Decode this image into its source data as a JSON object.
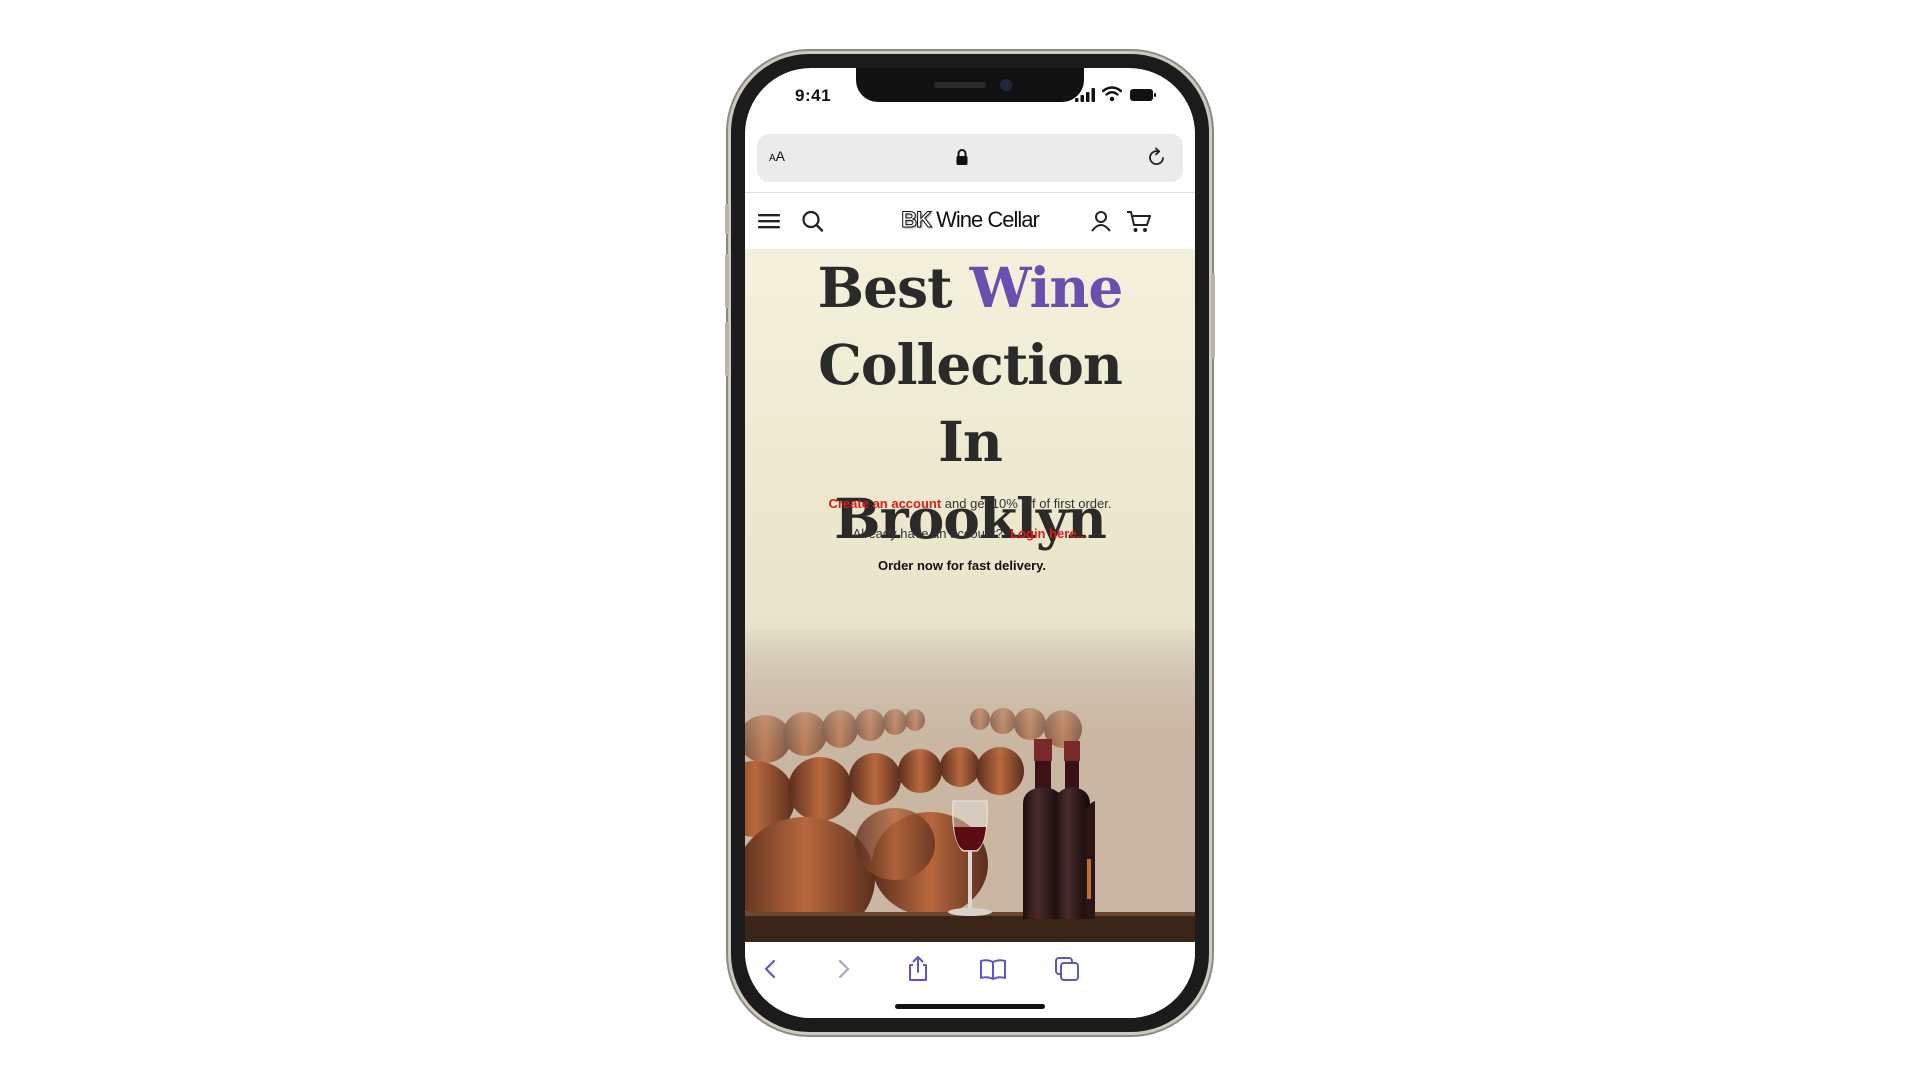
{
  "status_bar": {
    "time": "9:41"
  },
  "browser": {
    "text_size_label_small": "A",
    "text_size_label_large": "A"
  },
  "site": {
    "logo_prefix": "BK",
    "logo_text": " Wine Cellar"
  },
  "hero": {
    "headline_part1": "Best ",
    "headline_accent": "Wine",
    "headline_part2": "Collection",
    "headline_part3": "In",
    "headline_part4": "Brooklyn",
    "create_account_link": "Create an account",
    "create_account_text": " and get 10% off of first order.",
    "login_prompt": "Already have an account?",
    "login_link": "Login here...",
    "delivery_text": "Order now for fast delivery."
  },
  "icons": {
    "menu": "menu-icon",
    "search": "search-icon",
    "account": "user-icon",
    "cart": "cart-icon",
    "lock": "lock-icon",
    "reload": "reload-icon",
    "back": "chevron-left-icon",
    "forward": "chevron-right-icon",
    "share": "share-icon",
    "bookmarks": "book-icon",
    "tabs": "tabs-icon"
  },
  "colors": {
    "accent": "#6a4eb0",
    "link": "#e01b1b",
    "toolbar_icon": "#5b57c8"
  }
}
